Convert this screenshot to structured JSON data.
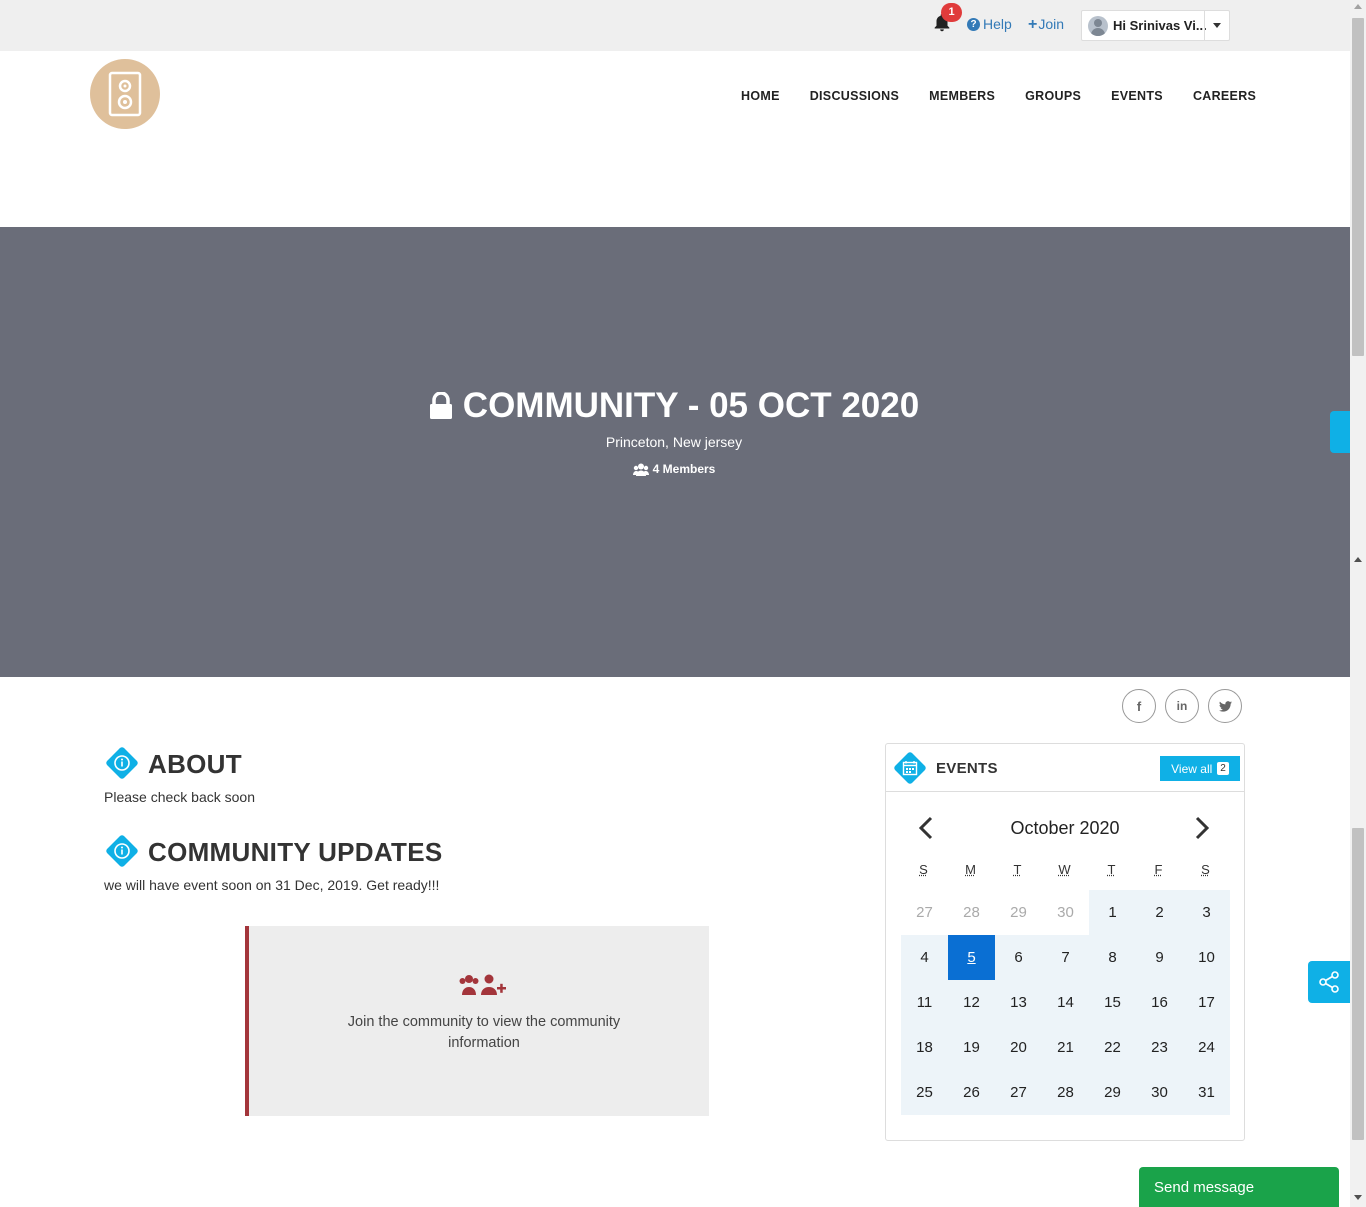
{
  "topbar": {
    "notification_count": "1",
    "help_label": "Help",
    "join_label": "Join",
    "user_name": "Hi Srinivas Vi..."
  },
  "nav": {
    "items": [
      "HOME",
      "DISCUSSIONS",
      "MEMBERS",
      "GROUPS",
      "EVENTS",
      "CAREERS"
    ]
  },
  "hero": {
    "title": "COMMUNITY - 05 OCT 2020",
    "location": "Princeton, New jersey",
    "members": "4 Members"
  },
  "about": {
    "title": "ABOUT",
    "text": "Please check back soon"
  },
  "updates": {
    "title": "COMMUNITY UPDATES",
    "text": "we will have event soon on 31 Dec, 2019. Get ready!!!"
  },
  "join_box": {
    "text": "Join the community to view the community information"
  },
  "events": {
    "title": "EVENTS",
    "view_all_label": "View all",
    "view_all_count": "2",
    "month": "October 2020",
    "days_of_week": [
      "S",
      "M",
      "T",
      "W",
      "T",
      "F",
      "S"
    ],
    "weeks": [
      [
        "27",
        "28",
        "29",
        "30",
        "1",
        "2",
        "3"
      ],
      [
        "4",
        "5",
        "6",
        "7",
        "8",
        "9",
        "10"
      ],
      [
        "11",
        "12",
        "13",
        "14",
        "15",
        "16",
        "17"
      ],
      [
        "18",
        "19",
        "20",
        "21",
        "22",
        "23",
        "24"
      ],
      [
        "25",
        "26",
        "27",
        "28",
        "29",
        "30",
        "31"
      ]
    ],
    "today": "5"
  },
  "send_message_label": "Send message",
  "colors": {
    "accent": "#0fb0e6",
    "hero_bg": "#6a6d79",
    "logo_bg": "#dfc09b",
    "join_border": "#a3353b",
    "today": "#0a6fd3",
    "send_message": "#1aa34a",
    "badge": "#e03b3b"
  },
  "icons": [
    "bell-icon",
    "help-icon",
    "plus-icon",
    "user-avatar",
    "caret-down-icon",
    "speaker-logo",
    "lock-icon",
    "users-icon",
    "facebook-icon",
    "linkedin-icon",
    "twitter-icon",
    "info-icon",
    "calendar-icon",
    "users-plus-icon",
    "chevron-left-icon",
    "chevron-right-icon",
    "share-icon"
  ]
}
